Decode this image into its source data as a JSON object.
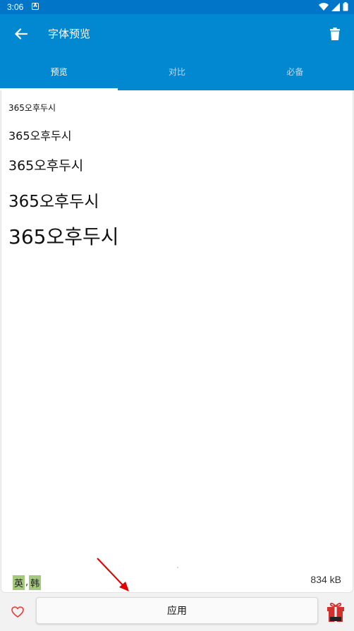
{
  "status_bar": {
    "time": "3:06",
    "notification_icon": "A"
  },
  "app_bar": {
    "title": "字体预览"
  },
  "tabs": [
    {
      "label": "预览",
      "active": true
    },
    {
      "label": "对比",
      "active": false
    },
    {
      "label": "必备",
      "active": false
    }
  ],
  "preview": {
    "lines": [
      "365오후두시",
      "365오후두시",
      "365오후두시",
      "365오후두시",
      "365오후두시"
    ]
  },
  "languages": {
    "first": "英",
    "separator": ",",
    "second": "韩"
  },
  "file_size": "834 kB",
  "bottom": {
    "apply_label": "应用"
  },
  "colors": {
    "primary": "#0288d1",
    "status_bar": "#0176c8",
    "lang_tag": "#a5c97c",
    "arrow": "#e00000",
    "heart": "#e53935"
  }
}
